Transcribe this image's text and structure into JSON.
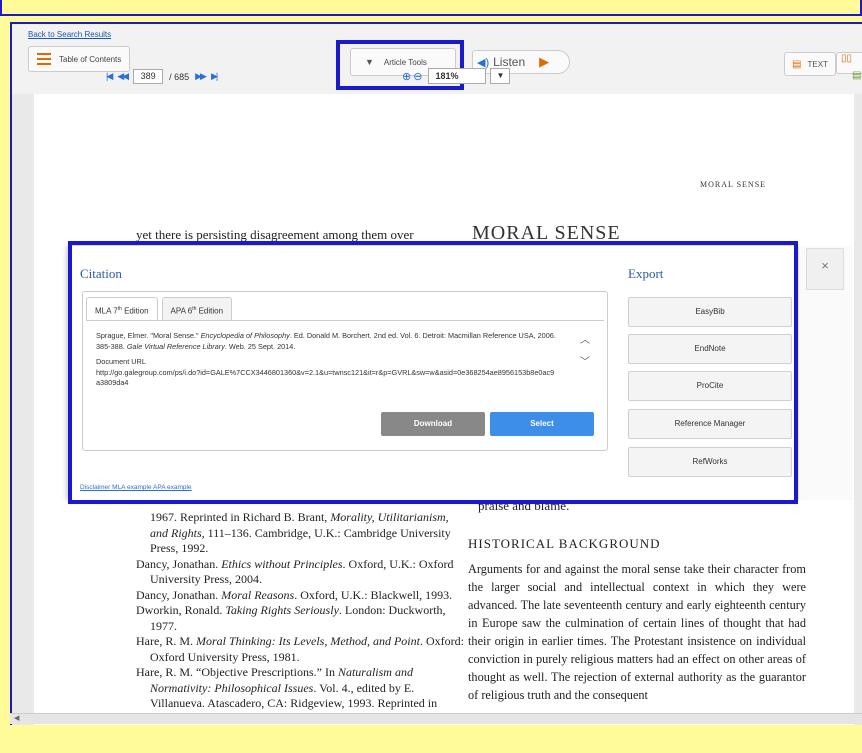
{
  "toolbar": {
    "back_link": "Back to Search Results",
    "toc_label": "Table of Contents",
    "article_tools_label": "Article Tools",
    "listen_label": "Listen",
    "text_label": "TEXT",
    "current_page": "389",
    "total_pages": "/ 685",
    "zoom_value": "181%"
  },
  "page": {
    "running_head": "MORAL SENSE",
    "left_line": "yet there is persisting disagreement among them over",
    "title": "MORAL SENSE",
    "praise_line": "praise and blame.",
    "references": [
      {
        "text": "1967. Reprinted in Richard B. Brant, ",
        "italic": "Morality, Utilitarianism, and Rights",
        "after": ", 111–136. Cambridge, U.K.: Cambridge University Press, 1992.",
        "cont": true
      },
      {
        "text": "Dancy, Jonathan. ",
        "italic": "Ethics without Principles",
        "after": ". Oxford, U.K.: Oxford University Press, 2004."
      },
      {
        "text": "Dancy, Jonathan. ",
        "italic": "Moral Reasons",
        "after": ". Oxford, U.K.: Blackwell, 1993."
      },
      {
        "text": "Dworkin, Ronald. ",
        "italic": "Taking Rights Seriously",
        "after": ". London: Duckworth, 1977."
      },
      {
        "text": "Hare, R. M. ",
        "italic": "Moral Thinking: Its Levels, Method, and Point",
        "after": ". Oxford: Oxford University Press, 1981."
      },
      {
        "text": "Hare, R. M. “Objective Prescriptions.” In ",
        "italic": "Naturalism and Normativity: Philosophical Issues",
        "after": ". Vol. 4., edited by E. Villanueva. Atascadero, CA: Ridgeview, 1993. Reprinted in"
      }
    ],
    "section_heading": "HISTORICAL BACKGROUND",
    "section_text": "Arguments for and against the moral sense take their character from the larger social and intellectual context in which they were advanced. The late seventeenth century and early eighteenth century in Europe saw the culmination of certain lines of thought that had their origin in earlier times. The Protestant insistence on individual conviction in purely religious matters had an effect on other areas of thought as well. The rejection of external authority as the guarantor of religious truth and the consequent"
  },
  "modal": {
    "citation_title": "Citation",
    "export_title": "Export",
    "close_label": "×",
    "tabs": [
      {
        "label": "MLA 7",
        "sup": "th",
        "rest": " Edition"
      },
      {
        "label": "APA 6",
        "sup": "th",
        "rest": " Edition"
      }
    ],
    "citation_pre": "Sprague, Elmer. \"Moral Sense.\" ",
    "citation_italic": "Encyclopedia of Philosophy",
    "citation_mid": ". Ed. Donald M. Borchert. 2nd ed. Vol. 6. Detroit: Macmillan Reference USA, 2006. 385-388. ",
    "citation_italic2": "Gale Virtual Reference Library",
    "citation_post": ". Web. 25 Sept. 2014.",
    "doc_url_label": "Document URL",
    "doc_url": "http://go.galegroup.com/ps/i.do?id=GALE%7CCX3446801360&v=2.1&u=twnsc121&it=r&p=GVRL&sw=w&asid=0e368254ae8956153b8e0ac9a3809da4",
    "download_label": "Download",
    "select_label": "Select",
    "export_buttons": [
      "EasyBib",
      "EndNote",
      "ProCite",
      "Reference Manager",
      "RefWorks"
    ],
    "footer_links": [
      "Disclaimer",
      "MLA example",
      "APA example"
    ]
  },
  "colors": {
    "highlight": "#1a1acc",
    "background": "#fffb98",
    "link": "#2a58a8",
    "select": "#3d8ee8"
  }
}
